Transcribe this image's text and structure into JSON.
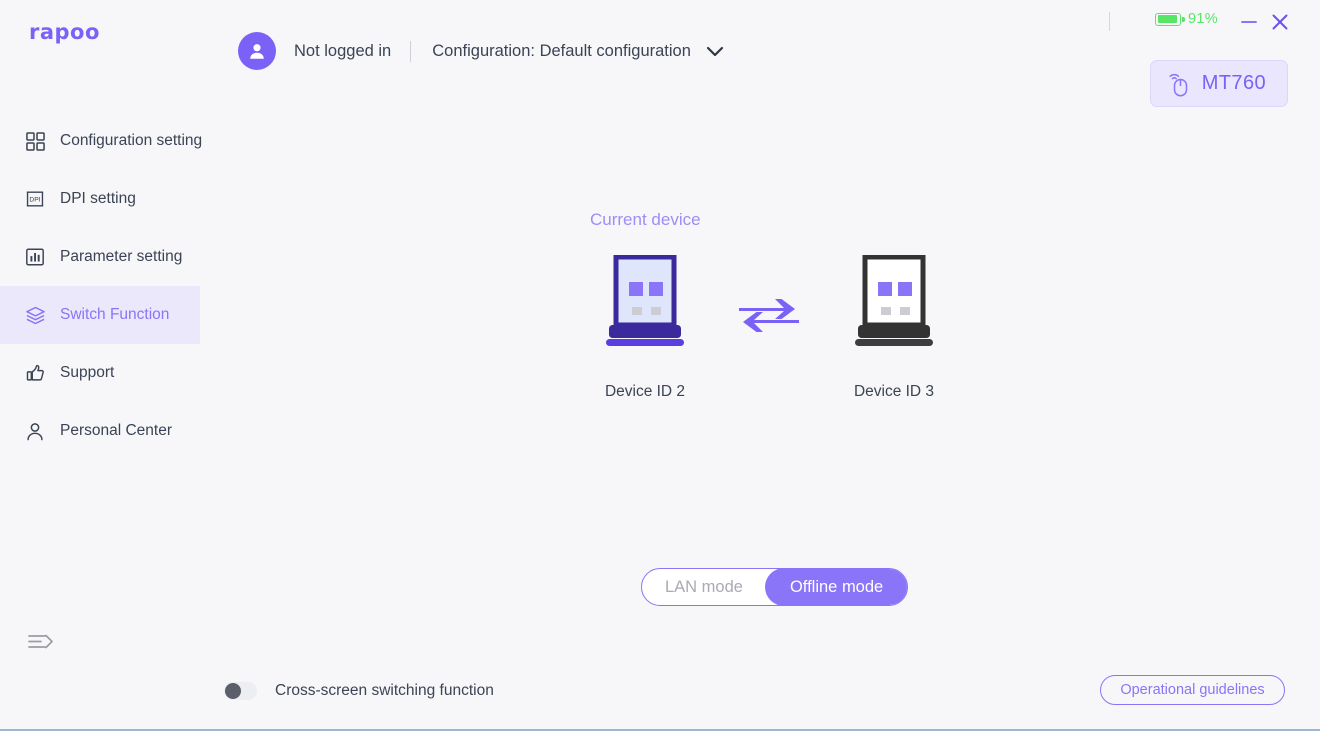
{
  "window": {
    "logo_text": "rapoo",
    "battery_percent": "91%",
    "battery_level": 91,
    "minimize_icon": "minimize-icon",
    "close_icon": "close-icon"
  },
  "header": {
    "avatar_icon": "user-avatar-icon",
    "login_status": "Not logged in",
    "configuration_label": "Configuration: Default configuration",
    "chevron_icon": "chevron-down-icon",
    "device_badge": {
      "name": "MT760",
      "icon": "wireless-mouse-icon"
    }
  },
  "sidebar": {
    "items": [
      {
        "label": "Configuration setting",
        "icon": "grid-icon",
        "active": false
      },
      {
        "label": "DPI setting",
        "icon": "dpi-icon",
        "active": false
      },
      {
        "label": "Parameter setting",
        "icon": "bar-chart-icon",
        "active": false
      },
      {
        "label": "Switch Function",
        "icon": "layers-icon",
        "active": true
      },
      {
        "label": "Support",
        "icon": "thumbs-up-icon",
        "active": false
      },
      {
        "label": "Personal Center",
        "icon": "person-icon",
        "active": false
      }
    ],
    "collapse_icon": "collapse-sidebar-icon"
  },
  "main": {
    "current_device_label": "Current device",
    "swap_icon": "swap-arrows-icon",
    "devices": [
      {
        "name": "Device ID 2",
        "state": "active"
      },
      {
        "name": "Device ID 3",
        "state": "inactive"
      }
    ],
    "mode_toggle": {
      "options": [
        {
          "label": "LAN mode",
          "selected": false
        },
        {
          "label": "Offline mode",
          "selected": true
        }
      ]
    }
  },
  "footer": {
    "cross_screen_label": "Cross-screen switching function",
    "cross_screen_enabled": false,
    "guidelines_label": "Operational guidelines"
  },
  "colors": {
    "accent": "#7b61f5",
    "accent_light": "#8a74f7",
    "accent_pale": "#9d8df6",
    "active_bg": "#ece8fc",
    "battery_green": "#57e665",
    "text": "#3b4354",
    "background": "#f7f7f9",
    "device_active_frame": "#3a2a9c",
    "device_inactive_frame": "#333333",
    "device_screen_active": "#dfe6fb",
    "device_key": "#8a74f7"
  }
}
